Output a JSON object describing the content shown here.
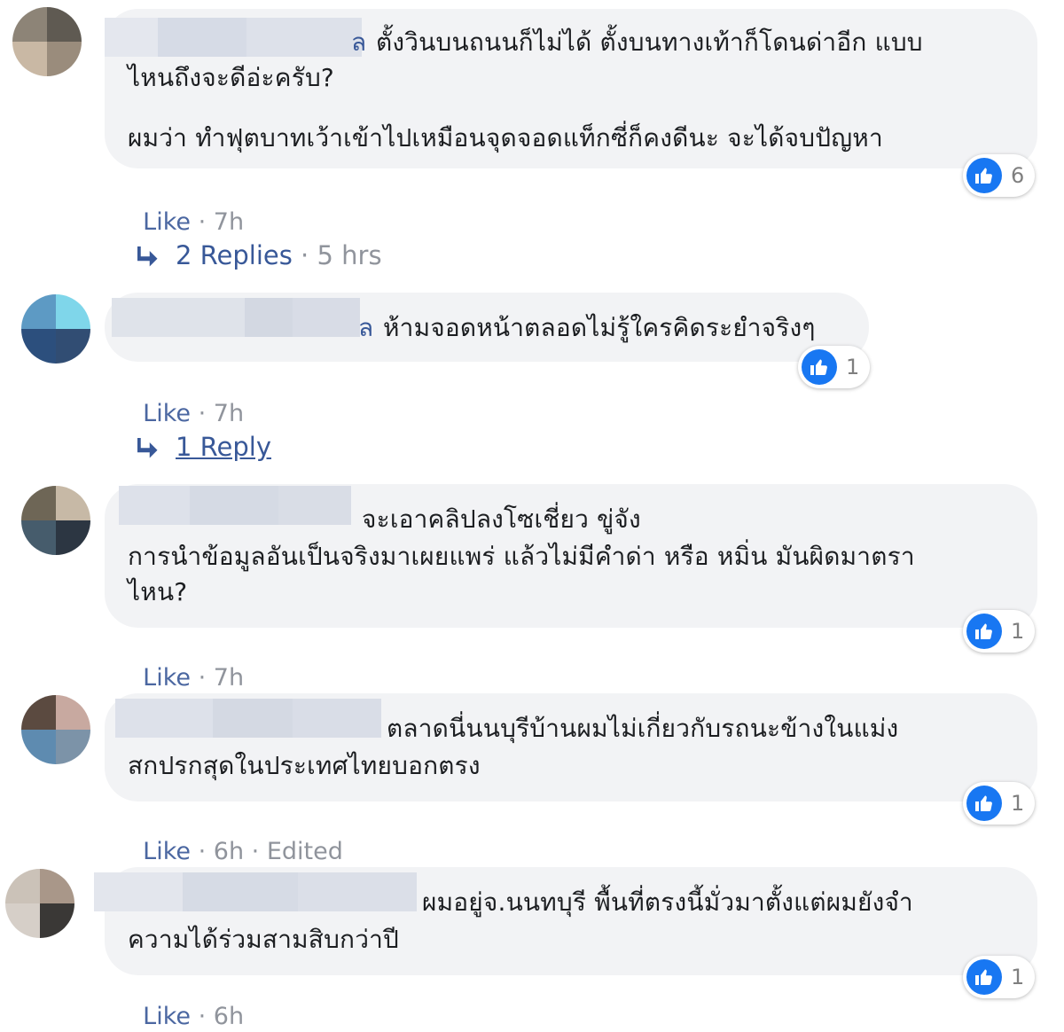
{
  "comments": [
    {
      "name_tail": "ล",
      "lines": [
        "ตั้งวินบนถนนก็ไม่ได้ ตั้งบนทางเท้าก็โดนด่าอีก แบบ",
        "ไหนถึงจะดีอ่ะครับ?",
        "",
        "ผมว่า ทำฟุตบาทเว้าเข้าไปเหมือนจุดจอดแท็กซี่ก็คงดีนะ จะได้จบปัญหา"
      ],
      "like": "Like",
      "time": "7h",
      "reaction_count": "6",
      "replies": {
        "label": "2 Replies",
        "time": "5 hrs"
      }
    },
    {
      "name_tail": "ล",
      "lines": [
        "ห้ามจอดหน้าตลอดไม่รู้ใครคิดระยำจริงๆ"
      ],
      "like": "Like",
      "time": "7h",
      "reaction_count": "1",
      "replies": {
        "label": "1 Reply"
      }
    },
    {
      "lines": [
        "จะเอาคลิปลงโซเชี่ยว ขู่จัง",
        "การนำข้อมูลอันเป็นจริงมาเผยแพร่ แล้วไม่มีคำด่า หรือ หมิ่น มันผิดมาตรา",
        "ไหน?"
      ],
      "like": "Like",
      "time": "7h",
      "reaction_count": "1"
    },
    {
      "lines": [
        "ตลาดนี่นนบุรีบ้านผมไม่เกี่ยวกับรถนะข้างในแม่ง",
        "สกปรกสุดในประเทศไทยบอกตรง"
      ],
      "like": "Like",
      "time": "6h",
      "edited": "Edited",
      "reaction_count": "1"
    },
    {
      "lines": [
        "ผมอยู่จ.นนทบุรี พื้นที่ตรงนี้มั่วมาตั้งแต่ผมยังจำ",
        "ความได้ร่วมสามสิบกว่าปี"
      ],
      "like": "Like",
      "time": "6h",
      "reaction_count": "1"
    }
  ],
  "icons": {
    "reaction": "like-thumb-icon",
    "reply_arrow": "reply-arrow-icon"
  },
  "colors": {
    "bubble": "#f2f3f5",
    "link": "#385898",
    "meta": "#90949c",
    "like_blue": "#1877f2"
  }
}
